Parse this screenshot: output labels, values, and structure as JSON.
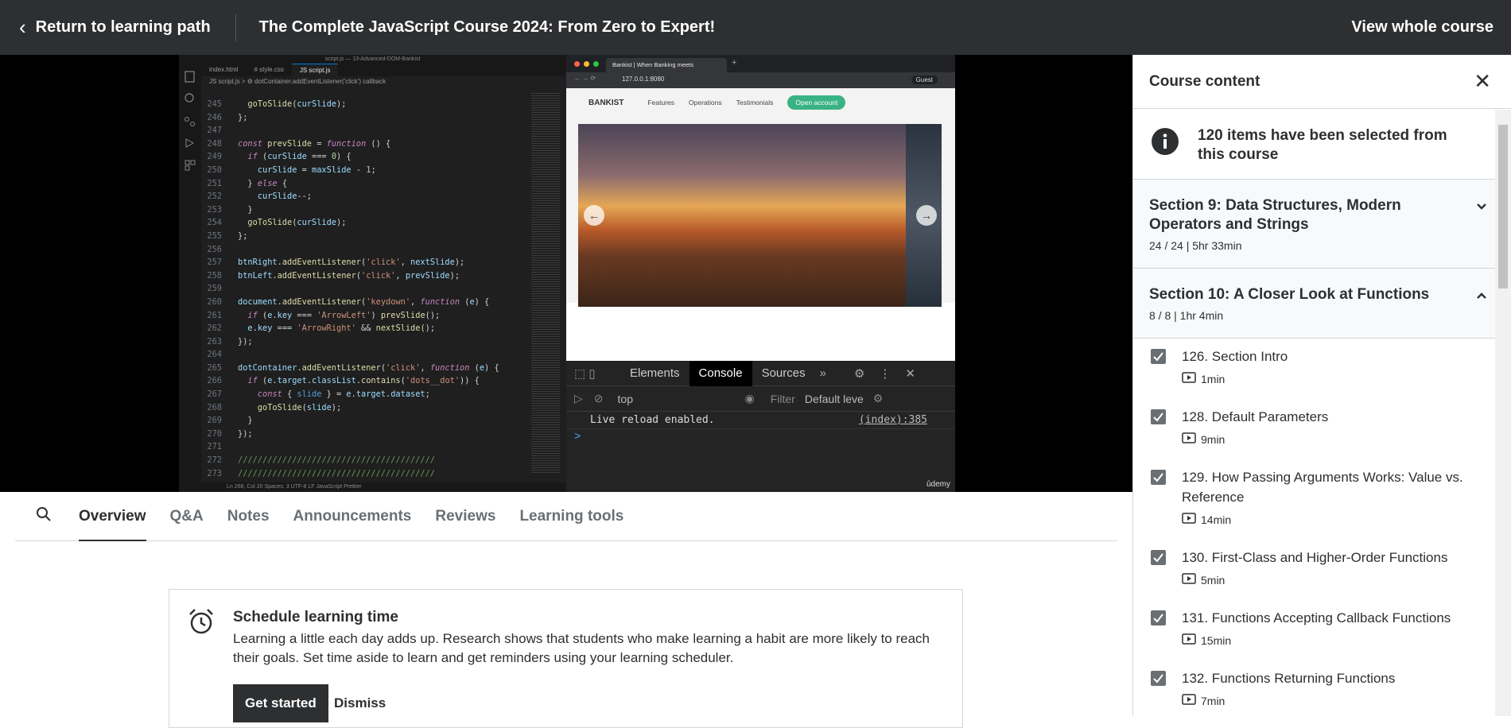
{
  "topbar": {
    "back_label": "Return to learning path",
    "course_title": "The Complete JavaScript Course 2024: From Zero to Expert!",
    "view_course": "View whole course"
  },
  "video": {
    "vscode": {
      "window_title": "script.js — 13-Advanced-DOM-Bankist",
      "tabs": [
        "index.html",
        "# style.css",
        "JS script.js"
      ],
      "breadcrumb": "JS script.js > ⚙ dotContainer.addEventListener('click') callback",
      "status": "Ln 268, Col 20   Spaces: 3   UTF-8   LF   JavaScript   Prettier",
      "line_numbers": [
        "245",
        "246",
        "247",
        "248",
        "249",
        "250",
        "251",
        "252",
        "253",
        "254",
        "255",
        "256",
        "257",
        "258",
        "259",
        "260",
        "261",
        "262",
        "263",
        "264",
        "265",
        "266",
        "267",
        "268",
        "269",
        "270",
        "271",
        "272",
        "273"
      ]
    },
    "browser": {
      "tab_title": "Bankist | When Banking meets",
      "url": "127.0.0.1:8080",
      "profile": "Guest",
      "logo": "BANKIST",
      "nav": [
        "Features",
        "Operations",
        "Testimonials"
      ],
      "cta": "Open account",
      "devtools_tabs": [
        "Elements",
        "Console",
        "Sources"
      ],
      "context": "top",
      "filter_placeholder": "Filter",
      "levels": "Default leve",
      "log_message": "Live reload enabled.",
      "log_source": "(index):385",
      "prompt": ">"
    },
    "watermark": "ûdemy"
  },
  "tabs": [
    "Overview",
    "Q&A",
    "Notes",
    "Announcements",
    "Reviews",
    "Learning tools"
  ],
  "schedule": {
    "title": "Schedule learning time",
    "description": "Learning a little each day adds up. Research shows that students who make learning a habit are more likely to reach their goals. Set time aside to learn and get reminders using your learning scheduler.",
    "start_label": "Get started",
    "dismiss_label": "Dismiss"
  },
  "sidebar": {
    "title": "Course content",
    "info": "120 items have been selected from this course",
    "sections": [
      {
        "title": "Section 9: Data Structures, Modern Operators and Strings",
        "meta": "24 / 24 | 5hr 33min",
        "expanded": false
      },
      {
        "title": "Section 10: A Closer Look at Functions",
        "meta": "8 / 8 | 1hr 4min",
        "expanded": true
      }
    ],
    "items": [
      {
        "title": "126. Section Intro",
        "duration": "1min",
        "checked": true
      },
      {
        "title": "128. Default Parameters",
        "duration": "9min",
        "checked": true
      },
      {
        "title": "129. How Passing Arguments Works: Value vs. Reference",
        "duration": "14min",
        "checked": true
      },
      {
        "title": "130. First-Class and Higher-Order Functions",
        "duration": "5min",
        "checked": true
      },
      {
        "title": "131. Functions Accepting Callback Functions",
        "duration": "15min",
        "checked": true
      },
      {
        "title": "132. Functions Returning Functions",
        "duration": "7min",
        "checked": true
      }
    ]
  }
}
